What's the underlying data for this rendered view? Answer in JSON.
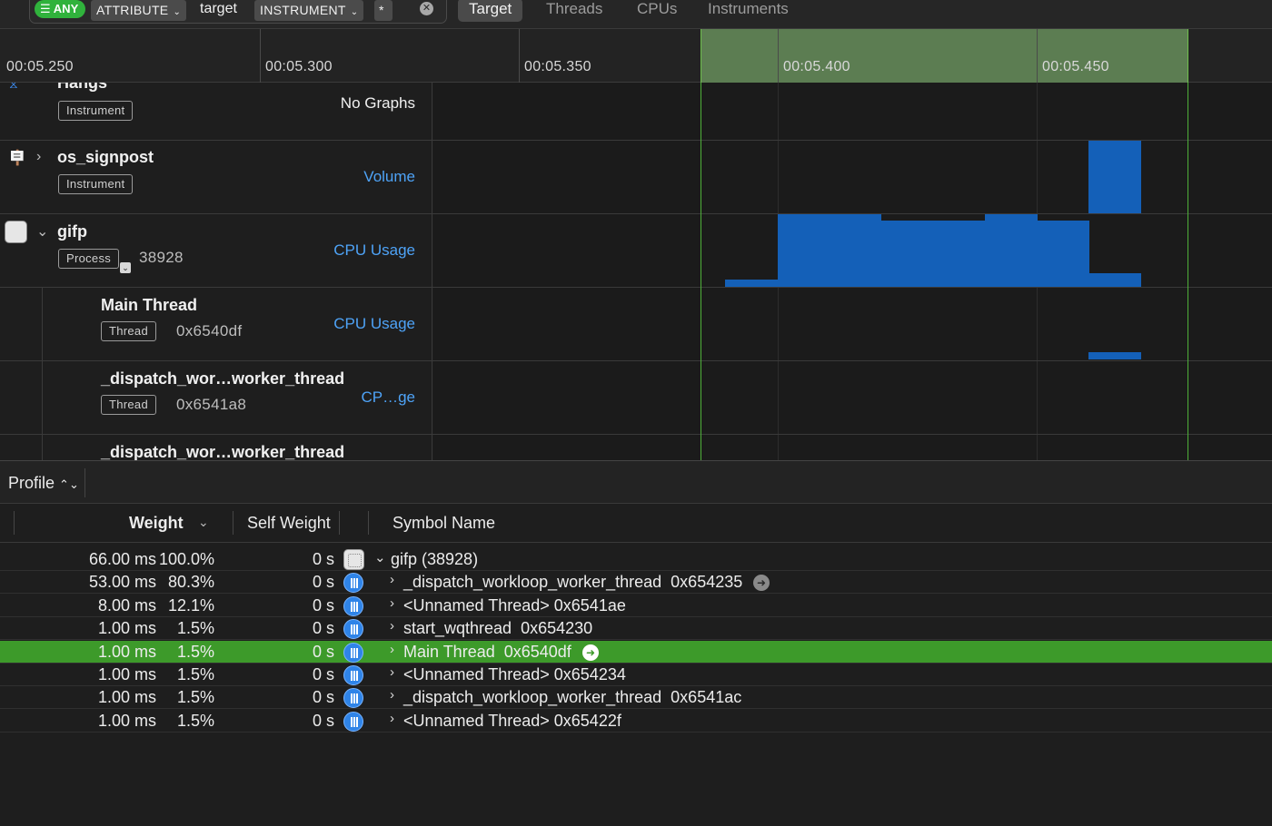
{
  "filter": {
    "any_badge": "ANY",
    "attribute_label": "ATTRIBUTE",
    "target_value": "target",
    "instrument_label": "INSTRUMENT",
    "star_value": "*"
  },
  "scope_tabs": [
    "Target",
    "Threads",
    "CPUs",
    "Instruments"
  ],
  "ruler": {
    "ticks": [
      "00:05.250",
      "00:05.300",
      "00:05.350",
      "00:05.400",
      "00:05.450"
    ]
  },
  "tracks": [
    {
      "title": "Hangs",
      "badge": "Instrument",
      "sub": "",
      "graph_kind": "No Graphs"
    },
    {
      "title": "os_signpost",
      "badge": "Instrument",
      "sub": "",
      "graph_kind": "Volume"
    },
    {
      "title": "gifp",
      "badge": "Process",
      "sub": "38928",
      "graph_kind": "CPU Usage"
    },
    {
      "title": "Main Thread",
      "badge": "Thread",
      "sub": "0x6540df",
      "graph_kind": "CPU Usage"
    },
    {
      "title": "_dispatch_wor…worker_thread",
      "badge": "Thread",
      "sub": "0x6541a8",
      "graph_kind": "CP…ge"
    },
    {
      "title": "_dispatch_wor…worker_thread",
      "badge": "",
      "sub": "",
      "graph_kind": ""
    }
  ],
  "profile": {
    "mode_label": "Profile",
    "columns": {
      "weight": "Weight",
      "self_weight": "Self Weight",
      "symbol_name": "Symbol Name"
    },
    "rows": [
      {
        "weight_ms": "66.00 ms",
        "weight_pct": "100.0%",
        "self": "0 s",
        "symbol": "gifp (38928)",
        "icon": "process-icon",
        "expanded": true,
        "selected": false,
        "go": false
      },
      {
        "weight_ms": "53.00 ms",
        "weight_pct": "80.3%",
        "self": "0 s",
        "symbol": "_dispatch_workloop_worker_thread  0x654235",
        "icon": "thread-icon",
        "expanded": false,
        "selected": false,
        "go": true
      },
      {
        "weight_ms": "8.00 ms",
        "weight_pct": "12.1%",
        "self": "0 s",
        "symbol": "<Unnamed Thread> 0x6541ae",
        "icon": "thread-icon",
        "expanded": false,
        "selected": false,
        "go": false
      },
      {
        "weight_ms": "1.00 ms",
        "weight_pct": "1.5%",
        "self": "0 s",
        "symbol": "start_wqthread  0x654230",
        "icon": "thread-icon",
        "expanded": false,
        "selected": false,
        "go": false
      },
      {
        "weight_ms": "1.00 ms",
        "weight_pct": "1.5%",
        "self": "0 s",
        "symbol": "Main Thread  0x6540df",
        "icon": "thread-icon",
        "expanded": false,
        "selected": true,
        "go": true
      },
      {
        "weight_ms": "1.00 ms",
        "weight_pct": "1.5%",
        "self": "0 s",
        "symbol": "<Unnamed Thread> 0x654234",
        "icon": "thread-icon",
        "expanded": false,
        "selected": false,
        "go": false
      },
      {
        "weight_ms": "1.00 ms",
        "weight_pct": "1.5%",
        "self": "0 s",
        "symbol": "_dispatch_workloop_worker_thread  0x6541ac",
        "icon": "thread-icon",
        "expanded": false,
        "selected": false,
        "go": false
      },
      {
        "weight_ms": "1.00 ms",
        "weight_pct": "1.5%",
        "self": "0 s",
        "symbol": "<Unnamed Thread> 0x65422f",
        "icon": "thread-icon",
        "expanded": false,
        "selected": false,
        "go": false
      }
    ]
  },
  "colors": {
    "selection_green": "#3d9a2a",
    "graph_blue": "#1460b8",
    "link_blue": "#4ea3f7"
  }
}
